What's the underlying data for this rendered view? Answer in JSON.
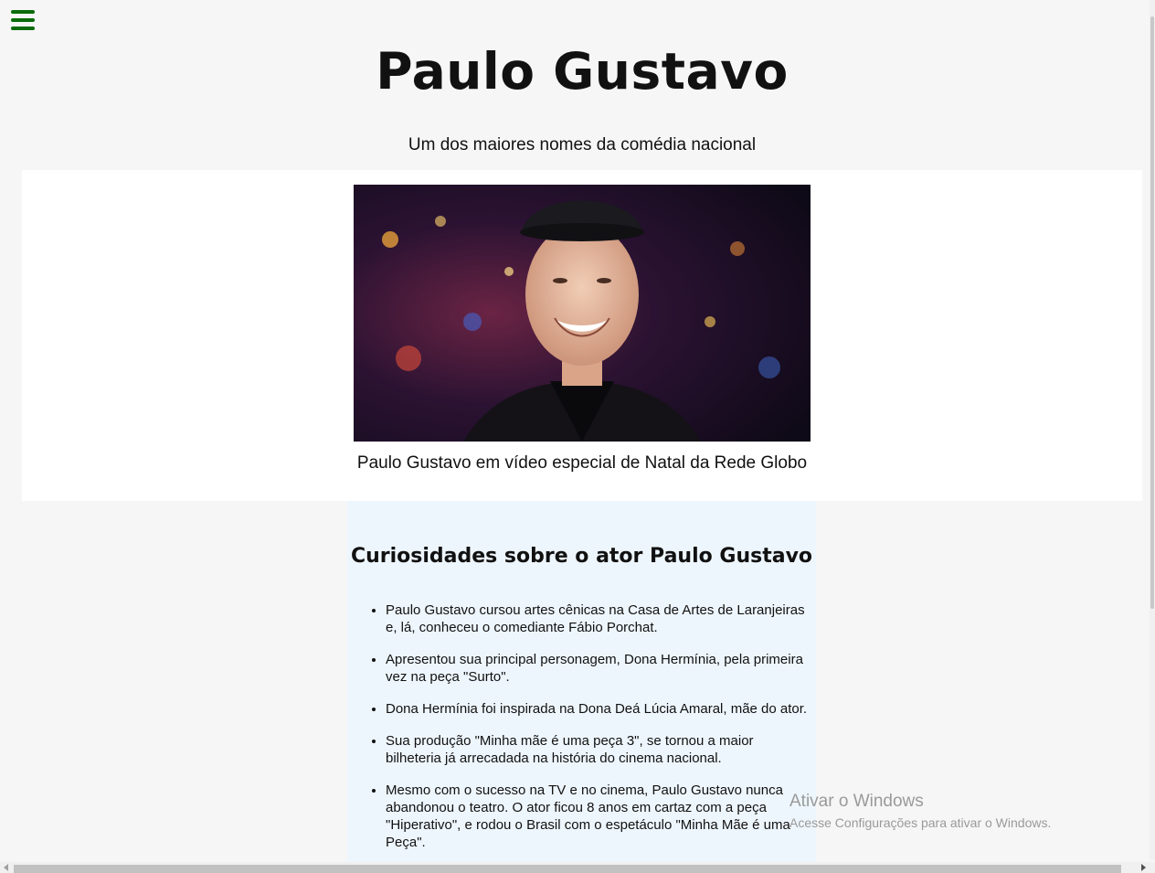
{
  "header": {
    "menu_icon": "hamburger-menu-icon",
    "menu_color": "#0b6b0b",
    "title": "Paulo Gustavo",
    "subtitle": "Um dos maiores nomes da comédia nacional"
  },
  "figure": {
    "image_alt": "Paulo Gustavo",
    "caption": "Paulo Gustavo em vídeo especial de Natal da Rede Globo"
  },
  "curiosities": {
    "title": "Curiosidades sobre o ator Paulo Gustavo",
    "background": "#eef6fd",
    "items": [
      "Paulo Gustavo cursou artes cênicas na Casa de Artes de Laranjeiras e, lá, conheceu o comediante Fábio Porchat.",
      "Apresentou sua principal personagem, Dona Hermínia, pela primeira vez na peça \"Surto\".",
      "Dona Hermínia foi inspirada na Dona Deá Lúcia Amaral, mãe do ator.",
      "Sua produção \"Minha mãe é uma peça 3\", se tornou a maior bilheteria já arrecadada na história do cinema nacional.",
      "Mesmo com o sucesso na TV e no cinema, Paulo Gustavo nunca abandonou o teatro. O ator ficou 8 anos em cartaz com a peça \"Hiperativo\", e rodou o Brasil com o espetáculo \"Minha Mãe é uma Peça\"."
    ]
  },
  "windows_watermark": {
    "title": "Ativar o Windows",
    "subtitle": "Acesse Configurações para ativar o Windows."
  }
}
